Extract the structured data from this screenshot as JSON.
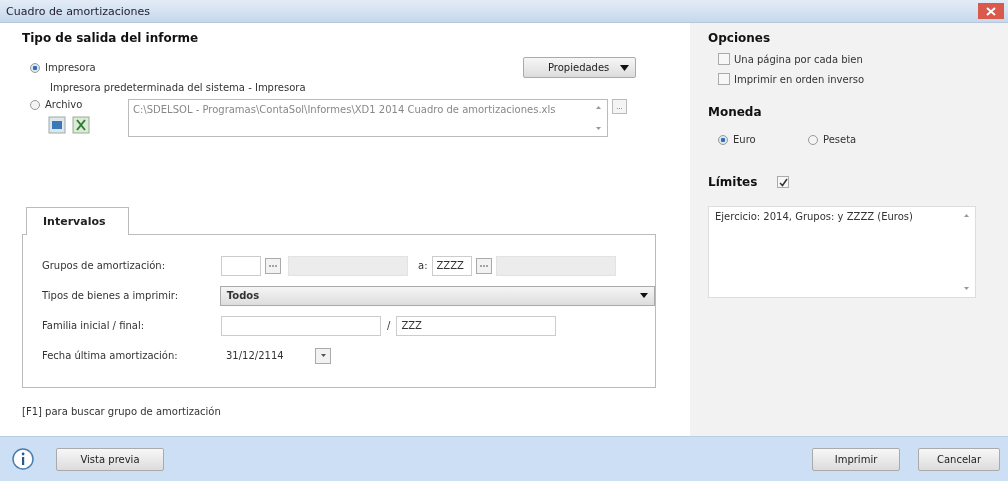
{
  "window": {
    "title": "Cuadro de amortizaciones"
  },
  "output": {
    "heading": "Tipo de salida del informe",
    "options": [
      {
        "label": "Impresora",
        "selected": true
      },
      {
        "label": "Archivo",
        "selected": false
      }
    ],
    "properties_button": "Propiedades",
    "printer_name": "Impresora predeterminada del sistema - Impresora",
    "file_path": "C:\\SDELSOL - Programas\\ContaSol\\Informes\\XD1 2014 Cuadro de amortizaciones.xls",
    "browse_button": "..."
  },
  "tabs": [
    {
      "label": "Intervalos",
      "selected": true
    }
  ],
  "intervals": {
    "groups_label": "Grupos de amortización:",
    "groups_separator": "a:",
    "groups_to": "ZZZZ",
    "types_label": "Tipos de bienes a imprimir:",
    "types_value": "Todos",
    "family_label": "Familia inicial / final:",
    "family_separator": "/",
    "family_to": "ZZZ",
    "date_label": "Fecha última amortización:",
    "date_value": "31/12/2114"
  },
  "hint": "[F1] para buscar grupo de amortización",
  "options": {
    "heading": "Opciones",
    "items": [
      {
        "label": "Una página por cada bien",
        "checked": false
      },
      {
        "label": "Imprimir en orden inverso",
        "checked": false
      }
    ]
  },
  "currency": {
    "heading": "Moneda",
    "items": [
      {
        "label": "Euro",
        "selected": true
      },
      {
        "label": "Peseta",
        "selected": false
      }
    ]
  },
  "limits": {
    "heading": "Límites",
    "checked": true,
    "text": "Ejercicio: 2014, Grupos:  y ZZZZ (Euros)"
  },
  "buttons": {
    "preview": "Vista previa",
    "print": "Imprimir",
    "cancel": "Cancelar"
  }
}
